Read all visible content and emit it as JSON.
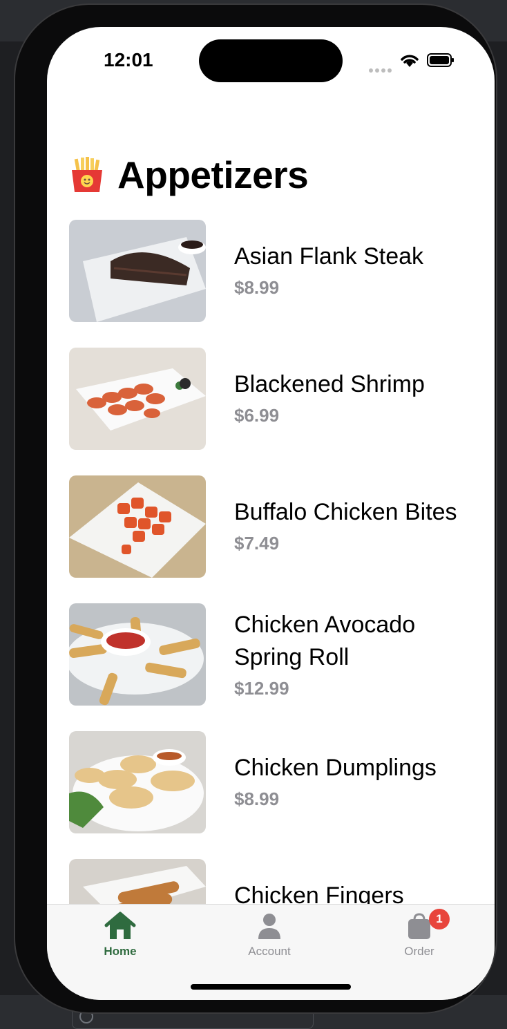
{
  "status_bar": {
    "time": "12:01"
  },
  "header": {
    "title": "Appetizers",
    "emoji_icon": "french-fries-icon"
  },
  "menu": {
    "items": [
      {
        "name": "Asian Flank Steak",
        "price": "$8.99"
      },
      {
        "name": "Blackened Shrimp",
        "price": "$6.99"
      },
      {
        "name": "Buffalo Chicken Bites",
        "price": "$7.49"
      },
      {
        "name": "Chicken Avocado Spring Roll",
        "price": "$12.99"
      },
      {
        "name": "Chicken Dumplings",
        "price": "$8.99"
      },
      {
        "name": "Chicken Fingers",
        "price": ""
      }
    ]
  },
  "tabbar": {
    "tabs": [
      {
        "label": "Home",
        "icon": "house-icon",
        "active": true
      },
      {
        "label": "Account",
        "icon": "person-icon",
        "active": false
      },
      {
        "label": "Order",
        "icon": "bag-icon",
        "active": false,
        "badge": "1"
      }
    ]
  },
  "colors": {
    "accent": "#2f6b3f",
    "badge": "#e8453c",
    "price_gray": "#8e8e93"
  }
}
